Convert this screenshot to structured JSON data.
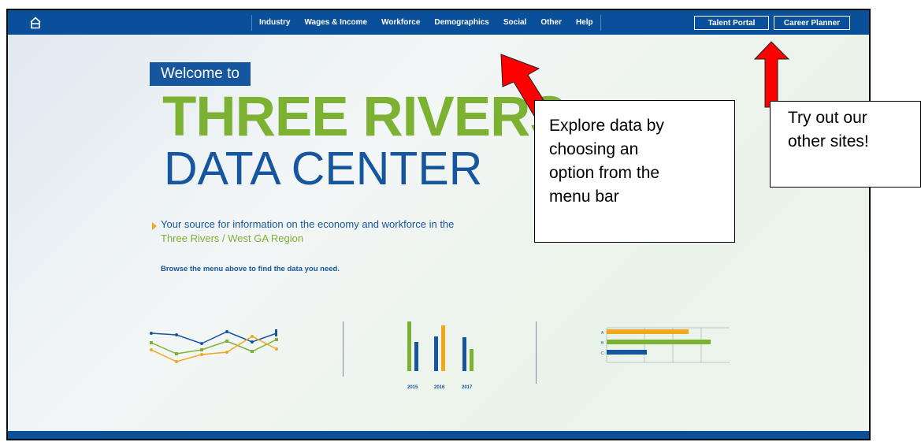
{
  "nav": {
    "items": [
      "Industry",
      "Wages & Income",
      "Workforce",
      "Demographics",
      "Social",
      "Other",
      "Help"
    ],
    "buttons": {
      "talent": "Talent Portal",
      "career": "Career Planner"
    }
  },
  "hero": {
    "welcome": "Welcome to",
    "title_line1": "THREE RIVERS",
    "title_line2": "DATA CENTER",
    "tagline_line1": "Your source for information on the economy and workforce in the",
    "tagline_line2": "Three Rivers / West GA Region",
    "browse": "Browse the menu above to find the data you need."
  },
  "graphics": {
    "bar_years": [
      "2015",
      "2016",
      "2017"
    ],
    "hbar_labels": [
      "A",
      "B",
      "C"
    ]
  },
  "callouts": {
    "menu": [
      "Explore data by",
      "choosing an",
      "option from the",
      "menu bar"
    ],
    "sites": [
      "Try out our",
      "other sites!"
    ]
  },
  "colors": {
    "navy": "#0a4f9a",
    "green": "#7db132",
    "orange": "#f0a81d",
    "arrow_red": "#ff0000"
  }
}
